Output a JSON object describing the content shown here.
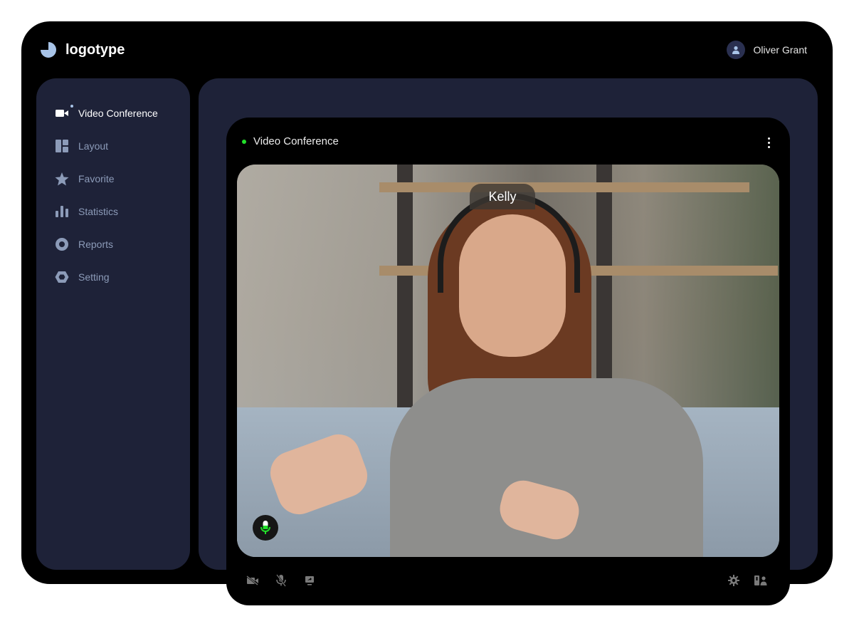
{
  "brand": {
    "logo_text": "logotype"
  },
  "user": {
    "name": "Oliver Grant",
    "icon": "user-icon"
  },
  "sidebar": {
    "items": [
      {
        "label": "Video Conference",
        "icon": "video-camera-icon",
        "active": true
      },
      {
        "label": "Layout",
        "icon": "layout-icon",
        "active": false
      },
      {
        "label": "Favorite",
        "icon": "star-icon",
        "active": false
      },
      {
        "label": "Statistics",
        "icon": "bar-chart-icon",
        "active": false
      },
      {
        "label": "Reports",
        "icon": "ring-icon",
        "active": false
      },
      {
        "label": "Setting",
        "icon": "hexagon-icon",
        "active": false
      }
    ]
  },
  "conference": {
    "title": "Video Conference",
    "status": "live",
    "more_icon": "more-vertical-icon",
    "participant_name": "Kelly",
    "mic_active": true,
    "controls_left": [
      "camera-off-icon",
      "mic-off-icon",
      "screen-share-icon"
    ],
    "controls_right": [
      "settings-gear-icon",
      "participants-icon"
    ]
  },
  "colors": {
    "frame": "#000000",
    "panel": "#1e2238",
    "live": "#22e02a",
    "icon_muted": "#8c9bb8",
    "accent_light": "#a8c4e8"
  }
}
